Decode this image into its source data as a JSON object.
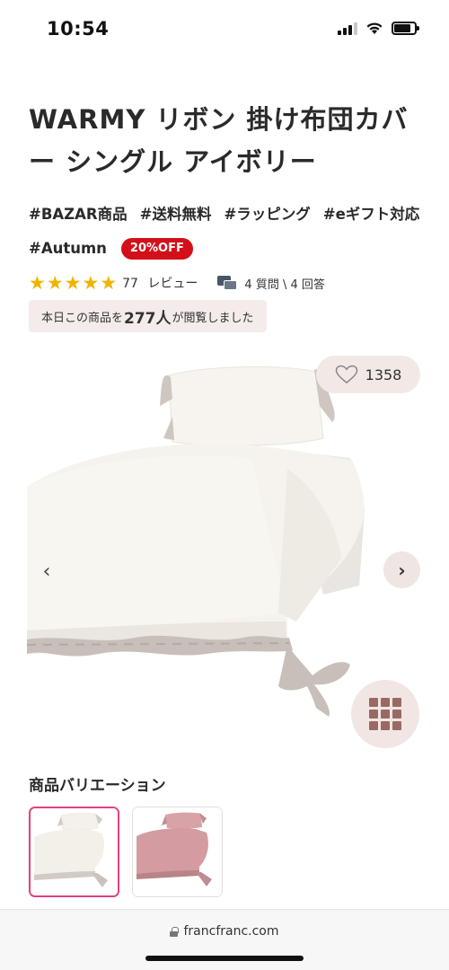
{
  "status_bar": {
    "time": "10:54"
  },
  "product": {
    "title": "WARMY リボン 掛け布団カバー シングル アイボリー",
    "tags": [
      "#BAZAR商品",
      "#送料無料",
      "#ラッピング",
      "#eギフト対応",
      "#Autumn"
    ],
    "discount_badge": "20%OFF",
    "rating": {
      "stars": 5,
      "review_count": "77",
      "review_label": "レビュー"
    },
    "qa_text": "4 質問 \\ 4 回答",
    "viewers": {
      "prefix": "本日この商品を",
      "count": "277人",
      "suffix": "が閲覧しました"
    }
  },
  "gallery": {
    "favorite_count": "1358",
    "prev_icon": "‹",
    "next_icon": "›",
    "grid_icon": "grid-icon"
  },
  "variations": {
    "title": "商品バリエーション",
    "items": [
      {
        "color_name": "ivory",
        "selected": true
      },
      {
        "color_name": "pink",
        "selected": false
      }
    ]
  },
  "browser": {
    "url": "francfranc.com"
  },
  "colors": {
    "accent_pink": "#e2407f",
    "badge_red": "#d3101a",
    "star": "#f0b400",
    "soft_bg": "#f2e9e7"
  }
}
